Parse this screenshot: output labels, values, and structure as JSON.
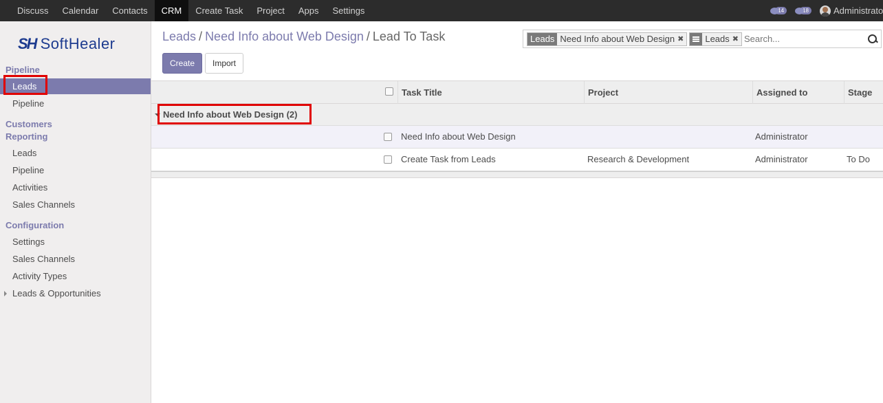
{
  "topbar": {
    "menu": [
      "Discuss",
      "Calendar",
      "Contacts",
      "CRM",
      "Create Task",
      "Project",
      "Apps",
      "Settings"
    ],
    "active": "CRM",
    "messages_count": "14",
    "activities_count": "18",
    "user": "Administrator"
  },
  "logo": {
    "mark": "SH",
    "text": "SoftHealer"
  },
  "sidebar": {
    "pipeline_section": "Pipeline",
    "leads": "Leads",
    "pipeline": "Pipeline",
    "customers_section": "Customers",
    "reporting_section": "Reporting",
    "rep_leads": "Leads",
    "rep_pipeline": "Pipeline",
    "rep_activities": "Activities",
    "rep_sales_channels": "Sales Channels",
    "config_section": "Configuration",
    "cfg_settings": "Settings",
    "cfg_sales_channels": "Sales Channels",
    "cfg_activity_types": "Activity Types",
    "cfg_leads_opps": "Leads & Opportunities"
  },
  "breadcrumb": {
    "item1": "Leads",
    "item2": "Need Info about Web Design",
    "current": "Lead To Task",
    "separator": "/"
  },
  "buttons": {
    "create": "Create",
    "import": "Import"
  },
  "search": {
    "facet1_tag": "Leads",
    "facet1_value": "Need Info about Web Design",
    "facet2_value": "Leads",
    "placeholder": "Search..."
  },
  "list": {
    "columns": {
      "task_title": "Task Title",
      "project": "Project",
      "assigned_to": "Assigned to",
      "stage": "Stage"
    },
    "group_label": "Need Info about Web Design (2)",
    "rows": [
      {
        "task_title": "Need Info about Web Design",
        "project": "",
        "assigned_to": "Administrator",
        "stage": ""
      },
      {
        "task_title": "Create Task from Leads",
        "project": "Research & Development",
        "assigned_to": "Administrator",
        "stage": "To Do"
      }
    ]
  },
  "colors": {
    "brand": "#7c7bad",
    "navbar": "#2c2c2c",
    "highlight": "#e00000",
    "logo": "#1d3b8f"
  }
}
